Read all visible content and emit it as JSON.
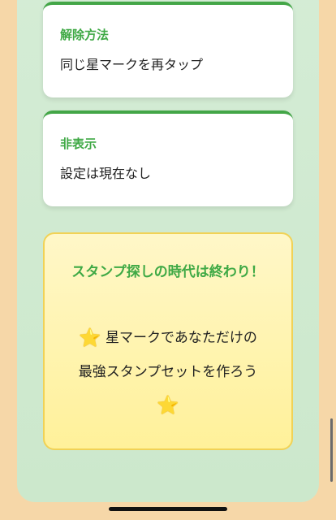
{
  "cards": [
    {
      "title": "解除方法",
      "body": "同じ星マークを再タップ"
    },
    {
      "title": "非表示",
      "body": "設定は現在なし"
    }
  ],
  "highlight": {
    "title": "スタンプ探しの時代は終わり！",
    "line1": "星マークであなただけの",
    "line2": "最強スタンプセットを作ろう",
    "star_glyph": "⭐"
  },
  "colors": {
    "accent_green": "#3fa945",
    "background_peach": "#f6d7a8",
    "panel_mint": "#d4ecd5",
    "highlight_yellow": "#fff19a"
  }
}
